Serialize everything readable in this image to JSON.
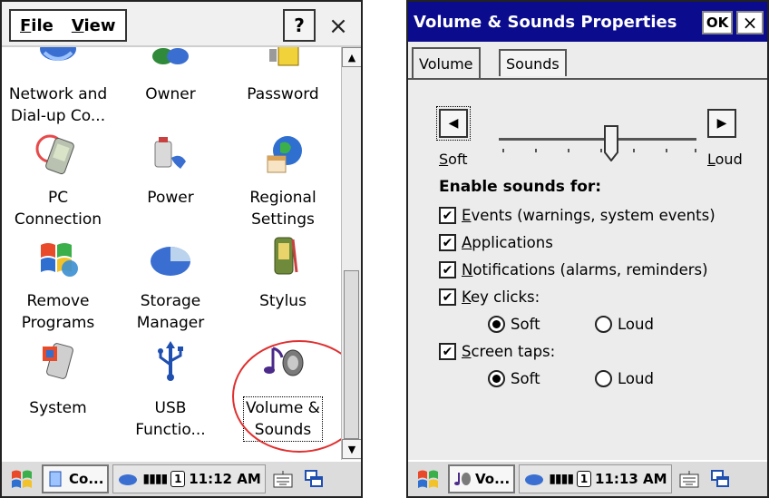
{
  "left": {
    "menu": {
      "file": "File",
      "view": "View",
      "help": "?",
      "close": "×"
    },
    "items": [
      {
        "label": "Network and\nDial-up Co...",
        "icon": "network-icon"
      },
      {
        "label": "Owner",
        "icon": "owner-icon"
      },
      {
        "label": "Password",
        "icon": "password-icon"
      },
      {
        "label": "PC\nConnection",
        "icon": "pc-connection-icon"
      },
      {
        "label": "Power",
        "icon": "power-icon"
      },
      {
        "label": "Regional\nSettings",
        "icon": "regional-settings-icon"
      },
      {
        "label": "Remove\nPrograms",
        "icon": "remove-programs-icon"
      },
      {
        "label": "Storage\nManager",
        "icon": "storage-manager-icon"
      },
      {
        "label": "Stylus",
        "icon": "stylus-icon"
      },
      {
        "label": "System",
        "icon": "system-icon"
      },
      {
        "label": "USB\nFunctio...",
        "icon": "usb-icon"
      },
      {
        "label": "Volume &\nSounds",
        "icon": "volume-sounds-icon"
      }
    ],
    "taskbar": {
      "task": "Co...",
      "one": "1",
      "time": "11:12 AM"
    }
  },
  "right": {
    "title": "Volume & Sounds Properties",
    "ok": "OK",
    "close": "×",
    "tabs": [
      "Volume",
      "Sounds"
    ],
    "slider": {
      "left_label": "Soft",
      "right_label": "Loud",
      "value_fraction": 0.57
    },
    "heading": "Enable sounds for:",
    "checkboxes": [
      {
        "label": "Events (warnings, system events)",
        "checked": true
      },
      {
        "label": "Applications",
        "checked": true
      },
      {
        "label": "Notifications (alarms, reminders)",
        "checked": true
      },
      {
        "label": "Key clicks:",
        "checked": true
      },
      {
        "label": "Screen taps:",
        "checked": true
      }
    ],
    "keyclicks": {
      "soft": "Soft",
      "loud": "Loud",
      "selected": "Soft"
    },
    "screentaps": {
      "soft": "Soft",
      "loud": "Loud",
      "selected": "Soft"
    },
    "taskbar": {
      "task": "Vo...",
      "one": "1",
      "time": "11:13 AM"
    }
  },
  "colors": {
    "titlebar": "#0b0b8e",
    "highlight_circle": "#e03030",
    "taskbar": "#dcdcdc"
  }
}
